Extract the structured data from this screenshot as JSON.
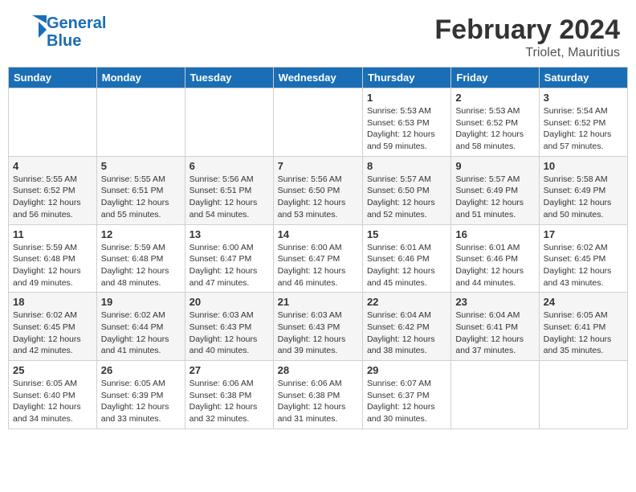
{
  "logo": {
    "line1": "General",
    "line2": "Blue"
  },
  "title": "February 2024",
  "subtitle": "Triolet, Mauritius",
  "days_of_week": [
    "Sunday",
    "Monday",
    "Tuesday",
    "Wednesday",
    "Thursday",
    "Friday",
    "Saturday"
  ],
  "weeks": [
    [
      {
        "day": "",
        "info": ""
      },
      {
        "day": "",
        "info": ""
      },
      {
        "day": "",
        "info": ""
      },
      {
        "day": "",
        "info": ""
      },
      {
        "day": "1",
        "info": "Sunrise: 5:53 AM\nSunset: 6:53 PM\nDaylight: 12 hours and 59 minutes."
      },
      {
        "day": "2",
        "info": "Sunrise: 5:53 AM\nSunset: 6:52 PM\nDaylight: 12 hours and 58 minutes."
      },
      {
        "day": "3",
        "info": "Sunrise: 5:54 AM\nSunset: 6:52 PM\nDaylight: 12 hours and 57 minutes."
      }
    ],
    [
      {
        "day": "4",
        "info": "Sunrise: 5:55 AM\nSunset: 6:52 PM\nDaylight: 12 hours and 56 minutes."
      },
      {
        "day": "5",
        "info": "Sunrise: 5:55 AM\nSunset: 6:51 PM\nDaylight: 12 hours and 55 minutes."
      },
      {
        "day": "6",
        "info": "Sunrise: 5:56 AM\nSunset: 6:51 PM\nDaylight: 12 hours and 54 minutes."
      },
      {
        "day": "7",
        "info": "Sunrise: 5:56 AM\nSunset: 6:50 PM\nDaylight: 12 hours and 53 minutes."
      },
      {
        "day": "8",
        "info": "Sunrise: 5:57 AM\nSunset: 6:50 PM\nDaylight: 12 hours and 52 minutes."
      },
      {
        "day": "9",
        "info": "Sunrise: 5:57 AM\nSunset: 6:49 PM\nDaylight: 12 hours and 51 minutes."
      },
      {
        "day": "10",
        "info": "Sunrise: 5:58 AM\nSunset: 6:49 PM\nDaylight: 12 hours and 50 minutes."
      }
    ],
    [
      {
        "day": "11",
        "info": "Sunrise: 5:59 AM\nSunset: 6:48 PM\nDaylight: 12 hours and 49 minutes."
      },
      {
        "day": "12",
        "info": "Sunrise: 5:59 AM\nSunset: 6:48 PM\nDaylight: 12 hours and 48 minutes."
      },
      {
        "day": "13",
        "info": "Sunrise: 6:00 AM\nSunset: 6:47 PM\nDaylight: 12 hours and 47 minutes."
      },
      {
        "day": "14",
        "info": "Sunrise: 6:00 AM\nSunset: 6:47 PM\nDaylight: 12 hours and 46 minutes."
      },
      {
        "day": "15",
        "info": "Sunrise: 6:01 AM\nSunset: 6:46 PM\nDaylight: 12 hours and 45 minutes."
      },
      {
        "day": "16",
        "info": "Sunrise: 6:01 AM\nSunset: 6:46 PM\nDaylight: 12 hours and 44 minutes."
      },
      {
        "day": "17",
        "info": "Sunrise: 6:02 AM\nSunset: 6:45 PM\nDaylight: 12 hours and 43 minutes."
      }
    ],
    [
      {
        "day": "18",
        "info": "Sunrise: 6:02 AM\nSunset: 6:45 PM\nDaylight: 12 hours and 42 minutes."
      },
      {
        "day": "19",
        "info": "Sunrise: 6:02 AM\nSunset: 6:44 PM\nDaylight: 12 hours and 41 minutes."
      },
      {
        "day": "20",
        "info": "Sunrise: 6:03 AM\nSunset: 6:43 PM\nDaylight: 12 hours and 40 minutes."
      },
      {
        "day": "21",
        "info": "Sunrise: 6:03 AM\nSunset: 6:43 PM\nDaylight: 12 hours and 39 minutes."
      },
      {
        "day": "22",
        "info": "Sunrise: 6:04 AM\nSunset: 6:42 PM\nDaylight: 12 hours and 38 minutes."
      },
      {
        "day": "23",
        "info": "Sunrise: 6:04 AM\nSunset: 6:41 PM\nDaylight: 12 hours and 37 minutes."
      },
      {
        "day": "24",
        "info": "Sunrise: 6:05 AM\nSunset: 6:41 PM\nDaylight: 12 hours and 35 minutes."
      }
    ],
    [
      {
        "day": "25",
        "info": "Sunrise: 6:05 AM\nSunset: 6:40 PM\nDaylight: 12 hours and 34 minutes."
      },
      {
        "day": "26",
        "info": "Sunrise: 6:05 AM\nSunset: 6:39 PM\nDaylight: 12 hours and 33 minutes."
      },
      {
        "day": "27",
        "info": "Sunrise: 6:06 AM\nSunset: 6:38 PM\nDaylight: 12 hours and 32 minutes."
      },
      {
        "day": "28",
        "info": "Sunrise: 6:06 AM\nSunset: 6:38 PM\nDaylight: 12 hours and 31 minutes."
      },
      {
        "day": "29",
        "info": "Sunrise: 6:07 AM\nSunset: 6:37 PM\nDaylight: 12 hours and 30 minutes."
      },
      {
        "day": "",
        "info": ""
      },
      {
        "day": "",
        "info": ""
      }
    ]
  ]
}
